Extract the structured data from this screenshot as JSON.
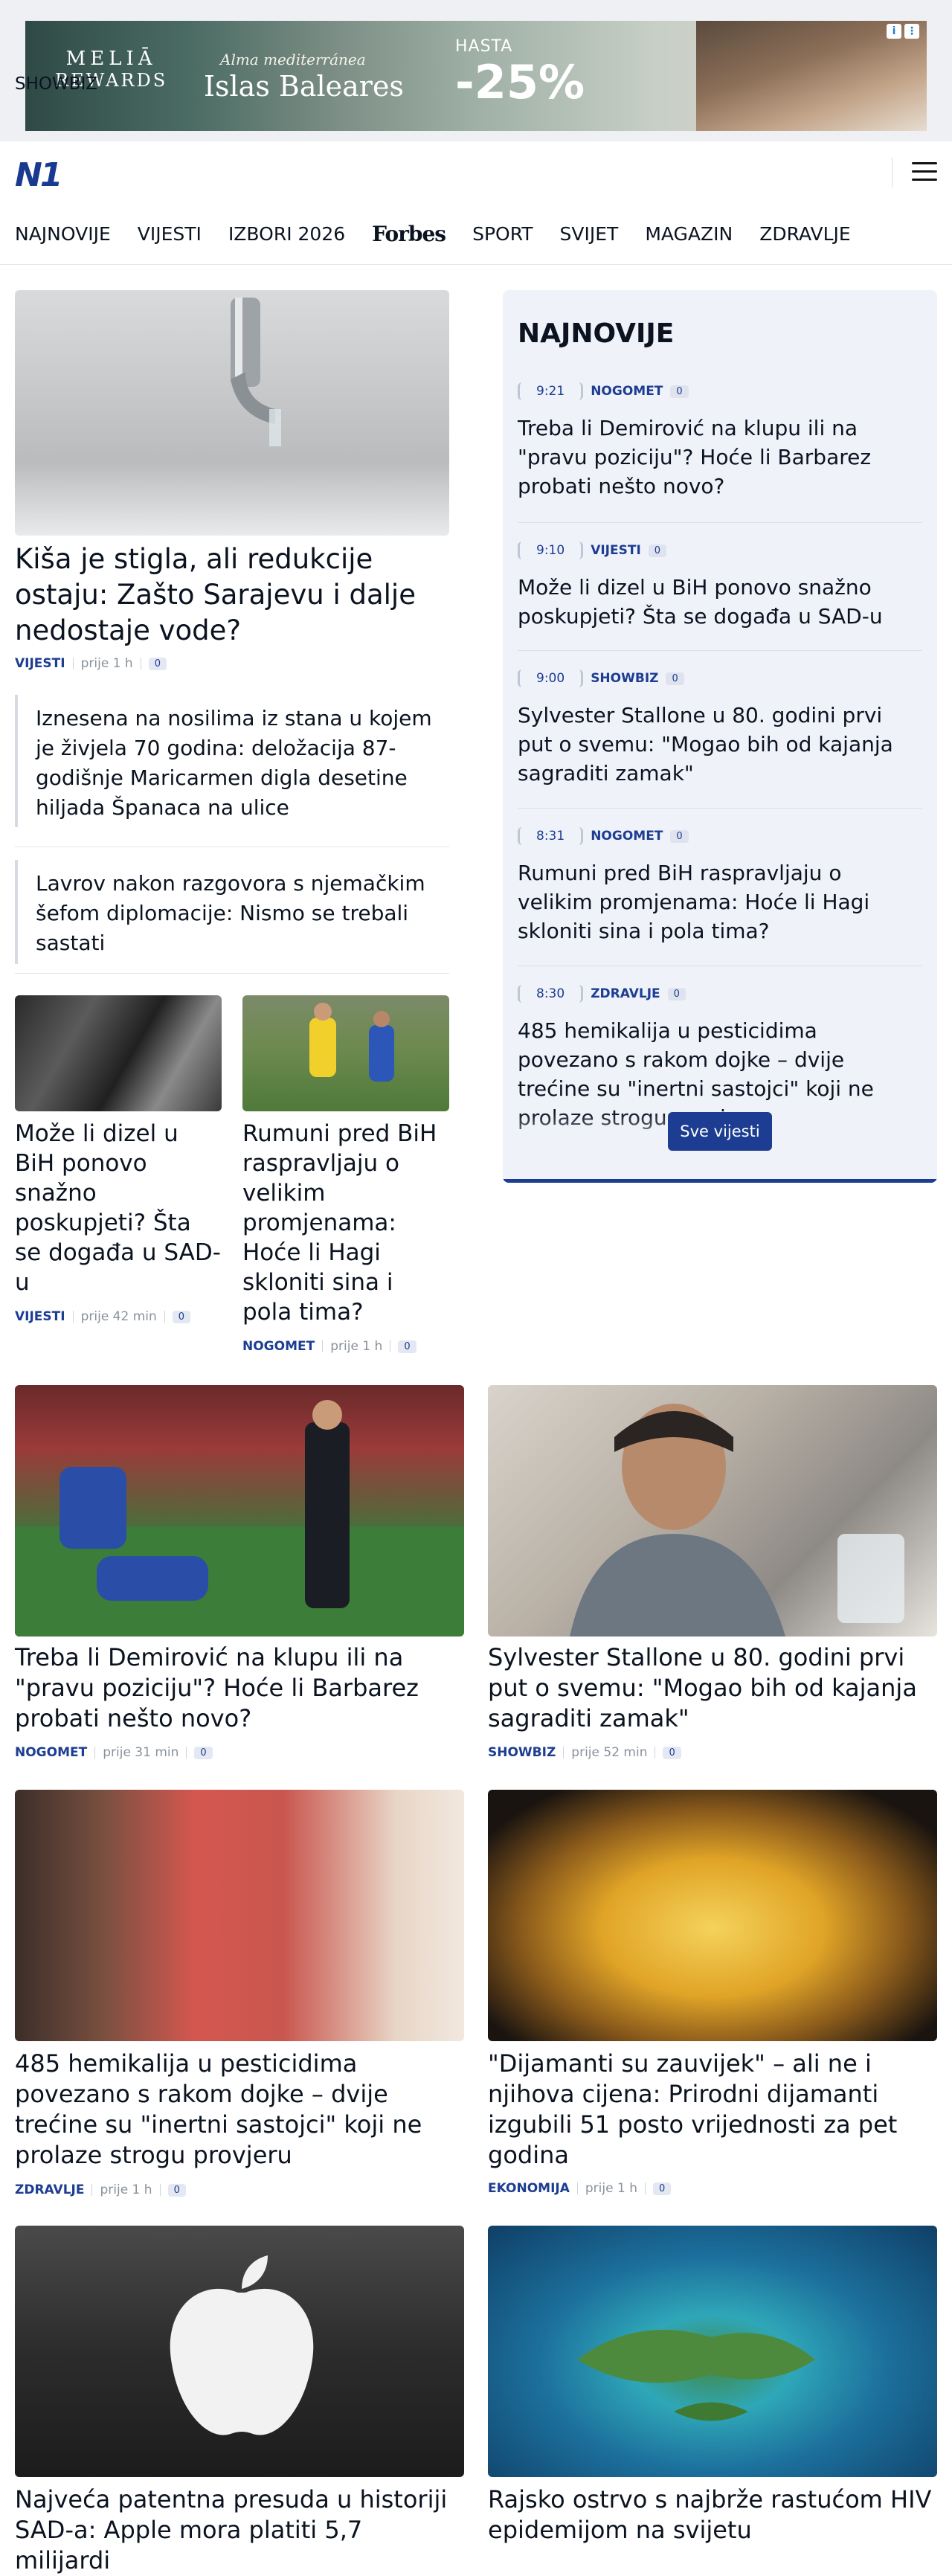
{
  "ad": {
    "brand_line1": "MELIĀ",
    "brand_line2": "REWARDS",
    "subtitle": "Alma mediterránea",
    "title": "Islas Baleares",
    "hasta": "HASTA",
    "discount": "-25%"
  },
  "header": {
    "logo": "N1"
  },
  "nav": {
    "items": [
      "NAJNOVIJE",
      "VIJESTI",
      "IZBORI 2026",
      "Forbes",
      "SPORT",
      "SVIJET",
      "MAGAZIN",
      "ZDRAVLJE"
    ],
    "second_row": "SHOWBIZ"
  },
  "lead": {
    "title": "Kiša je stigla, ali redukcije ostaju: Zašto Sarajevu i dalje nedostaje vode?",
    "category": "VIJESTI",
    "time": "prije 1 h",
    "comments": "0",
    "related": [
      "Iznesena na nosilima iz stana u kojem je živjela 70 godina: deložacija 87-godišnje Maricarmen digla desetine hiljada Španaca na ulice",
      "Lavrov nakon razgovora s njemačkim šefom diplomacije: Nismo se trebali sastati"
    ]
  },
  "small_cards": [
    {
      "title": "Može li dizel u BiH ponovo snažno poskupjeti? Šta se događa u SAD-u",
      "category": "VIJESTI",
      "time": "prije 42 min",
      "comments": "0"
    },
    {
      "title": "Rumuni pred BiH raspravljaju o velikim promjenama: Hoće li Hagi skloniti sina i pola tima?",
      "category": "NOGOMET",
      "time": "prije 1 h",
      "comments": "0"
    }
  ],
  "panel": {
    "title": "NAJNOVIJE",
    "button": "Sve vijesti",
    "items": [
      {
        "time": "9:21",
        "category": "NOGOMET",
        "comments": "0",
        "title": "Treba li Demirović na klupu ili na \"pravu poziciju\"? Hoće li Barbarez probati nešto novo?"
      },
      {
        "time": "9:10",
        "category": "VIJESTI",
        "comments": "0",
        "title": "Može li dizel u BiH ponovo snažno poskupjeti? Šta se događa u SAD-u"
      },
      {
        "time": "9:00",
        "category": "SHOWBIZ",
        "comments": "0",
        "title": "Sylvester Stallone u 80. godini prvi put o svemu: \"Mogao bih od kajanja sagraditi zamak\""
      },
      {
        "time": "8:31",
        "category": "NOGOMET",
        "comments": "0",
        "title": "Rumuni pred BiH raspravljaju o velikim promjenama: Hoće li Hagi skloniti sina i pola tima?"
      },
      {
        "time": "8:30",
        "category": "ZDRAVLJE",
        "comments": "0",
        "title": "485 hemikalija u pesticidima povezano s rakom dojke – dvije trećine su \"inertni sastojci\" koji ne prolaze strogu provjeru"
      }
    ]
  },
  "grid": [
    {
      "title": "Treba li Demirović na klupu ili na \"pravu poziciju\"? Hoće li Barbarez probati nešto novo?",
      "category": "NOGOMET",
      "time": "prije 31 min",
      "comments": "0"
    },
    {
      "title": "Sylvester Stallone u 80. godini prvi put o svemu: \"Mogao bih od kajanja sagraditi zamak\"",
      "category": "SHOWBIZ",
      "time": "prije 52 min",
      "comments": "0"
    },
    {
      "title": "485 hemikalija u pesticidima povezano s rakom dojke – dvije trećine su \"inertni sastojci\" koji ne prolaze strogu provjeru",
      "category": "ZDRAVLJE",
      "time": "prije 1 h",
      "comments": "0"
    },
    {
      "title": "\"Dijamanti su zauvijek\" – ali ne i njihova cijena: Prirodni dijamanti izgubili 51 posto vrijednosti za pet godina",
      "category": "EKONOMIJA",
      "time": "prije 1 h",
      "comments": "0"
    },
    {
      "title": "Najveća patentna presuda u historiji SAD-a: Apple mora platiti 5,7 milijardi",
      "category": "",
      "time": "",
      "comments": ""
    },
    {
      "title": "Rajsko ostrvo s najbrže rastućom HIV epidemijom na svijetu",
      "category": "",
      "time": "",
      "comments": ""
    }
  ]
}
